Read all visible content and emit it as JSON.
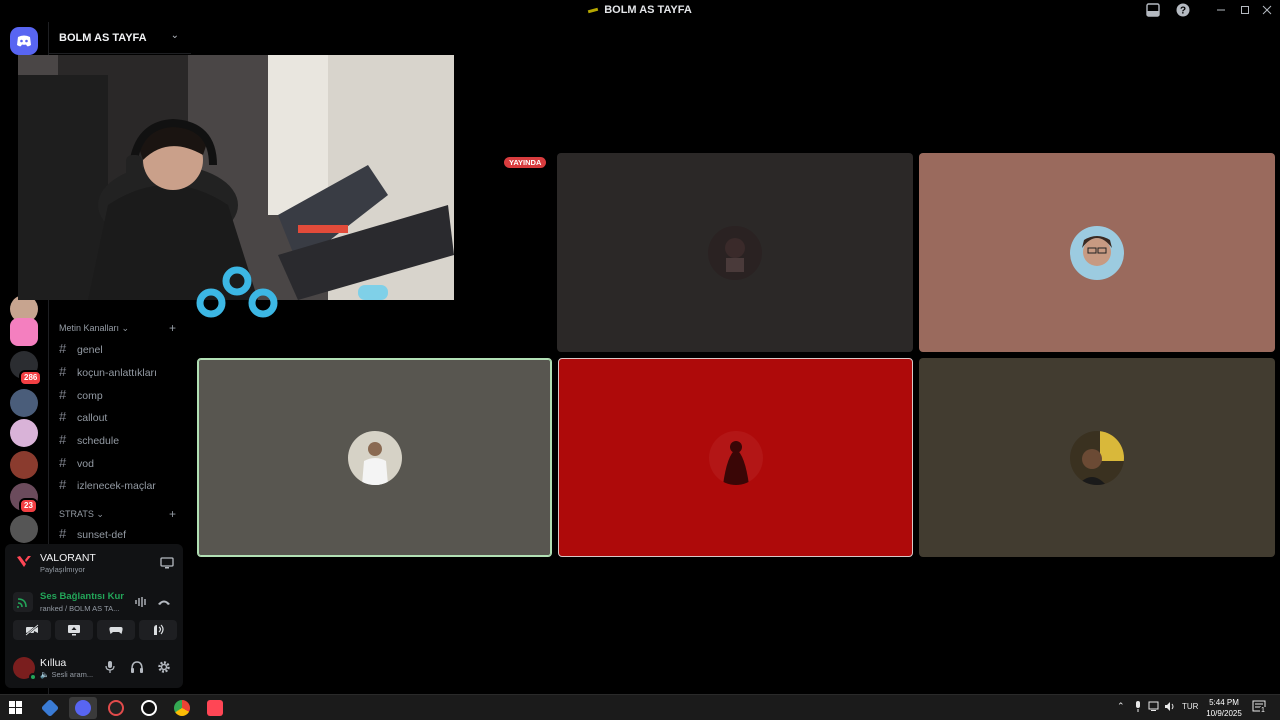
{
  "window": {
    "title": "BOLM AS TAYFA"
  },
  "server": {
    "name": "BOLM AS TAYFA"
  },
  "guild_badges": {
    "first": "286",
    "second": "23"
  },
  "channels": {
    "text_category": "Metin Kanalları",
    "text_channels": [
      "genel",
      "koçun-anlattıkları",
      "comp",
      "callout",
      "schedule",
      "vod",
      "izlenecek-maçlar"
    ],
    "strats_category": "STRATS",
    "strats_channels": [
      "sunset-def"
    ]
  },
  "stage": {
    "live_badge": "YAYINDA"
  },
  "activity": {
    "game": "VALORANT",
    "status": "Paylaşılmıyor"
  },
  "voice": {
    "title": "Ses Bağlantısı Kur",
    "channel": "ranked / BOLM AS TA..."
  },
  "user": {
    "name": "Kıllua",
    "status": "Sesli aram..."
  },
  "taskbar": {
    "lang": "TUR",
    "time": "5:44 PM",
    "date": "10/9/2025",
    "notif_count": "1"
  },
  "colors": {
    "accent_live": "#d83c3e",
    "connected_green": "#23a559",
    "speaking_ring": "#b2e0b5"
  }
}
